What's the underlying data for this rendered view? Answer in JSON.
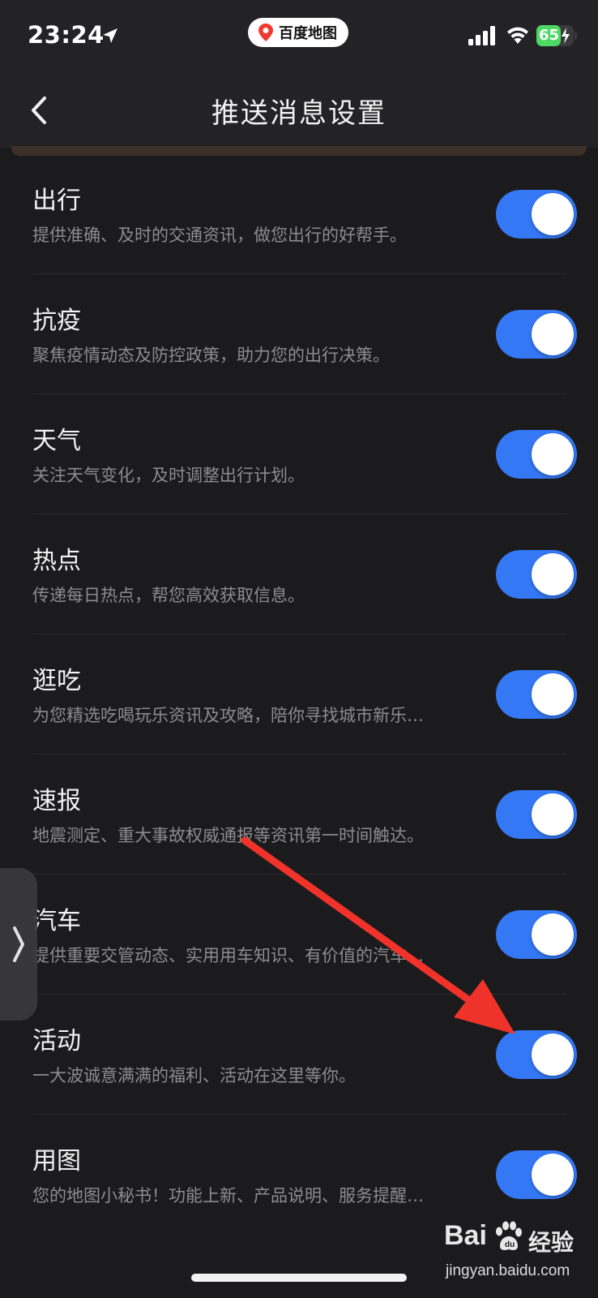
{
  "status_bar": {
    "time": "23:24",
    "app_pill_label": "百度地图",
    "battery_level": "65",
    "battery_fraction": 0.65,
    "icons": [
      "location-arrow-icon",
      "baidu-map-pin-icon",
      "cellular-signal-icon",
      "wifi-icon",
      "battery-charging-icon"
    ]
  },
  "nav": {
    "title": "推送消息设置",
    "back_icon": "chevron-left-icon"
  },
  "settings": [
    {
      "title": "出行",
      "desc": "提供准确、及时的交通资讯，做您出行的好帮手。",
      "enabled": true
    },
    {
      "title": "抗疫",
      "desc": "聚焦疫情动态及防控政策，助力您的出行决策。",
      "enabled": true
    },
    {
      "title": "天气",
      "desc": "关注天气变化，及时调整出行计划。",
      "enabled": true
    },
    {
      "title": "热点",
      "desc": "传递每日热点，帮您高效获取信息。",
      "enabled": true
    },
    {
      "title": "逛吃",
      "desc": "为您精选吃喝玩乐资讯及攻略，陪你寻找城市新乐…",
      "enabled": true
    },
    {
      "title": "速报",
      "desc": "地震测定、重大事故权威通报等资讯第一时间触达。",
      "enabled": true
    },
    {
      "title": "汽车",
      "desc": "提供重要交管动态、实用用车知识、有价值的汽车…",
      "enabled": true
    },
    {
      "title": "活动",
      "desc": "一大波诚意满满的福利、活动在这里等你。",
      "enabled": true
    },
    {
      "title": "用图",
      "desc": "您的地图小秘书！功能上新、产品说明、服务提醒…",
      "enabled": true
    }
  ],
  "colors": {
    "background": "#1b1b1d",
    "toggle_on": "#3478f6",
    "annotation_arrow": "#f0332a",
    "battery_green": "#4cd964"
  },
  "side_tab": {
    "icon": "chevron-right-icon"
  },
  "watermark": {
    "brand_bai": "Bai",
    "brand_jingyan": "经验",
    "url": "jingyan.baidu.com"
  }
}
